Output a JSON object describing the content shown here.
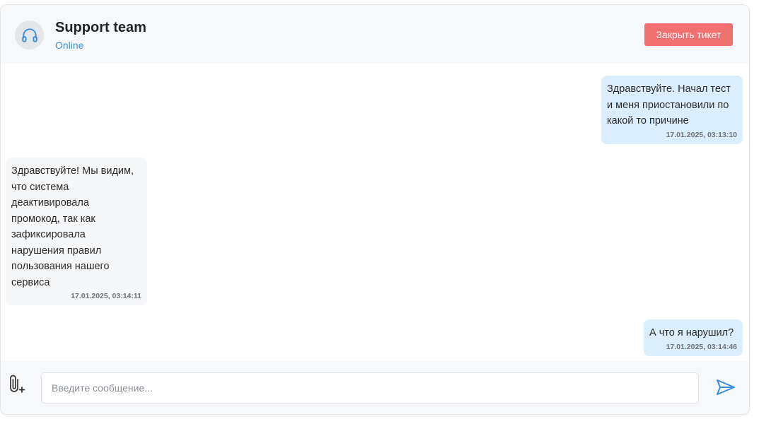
{
  "header": {
    "title": "Support team",
    "status": "Online",
    "close_button": "Закрыть тикет",
    "avatar_icon": "headphones-icon"
  },
  "messages": [
    {
      "direction": "outgoing",
      "lines": [
        "Здравствуйте. Начал тест",
        "и меня приостановили по",
        "какой то причине"
      ],
      "time": "17.01.2025, 03:13:10"
    },
    {
      "direction": "incoming",
      "lines": [
        "Здравствуйте! Мы видим,",
        "что система",
        "деактивировала",
        "промокод, так как",
        "зафиксировала",
        "нарушения правил",
        "пользования нашего",
        "сервиса"
      ],
      "time": "17.01.2025, 03:14:11"
    },
    {
      "direction": "outgoing",
      "lines": [
        "А что я нарушил?"
      ],
      "time": "17.01.2025, 03:14:46"
    }
  ],
  "composer": {
    "placeholder": "Введите сообщение...",
    "value": "",
    "attach_icon": "paperclip-plus-icon",
    "send_icon": "send-icon"
  },
  "colors": {
    "accent": "#3b8fe0",
    "close_button_bg": "#f07070",
    "outgoing_bubble": "#dbeeff",
    "incoming_bubble": "#f6f7f9",
    "header_bg": "#f7f8fa"
  }
}
